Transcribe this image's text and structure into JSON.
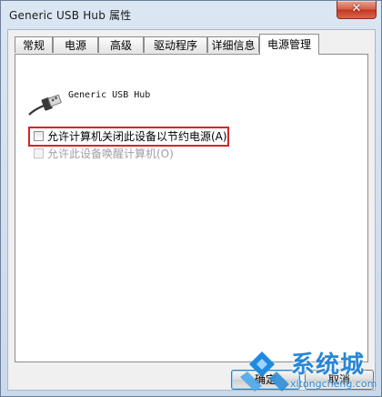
{
  "window": {
    "title": "Generic USB Hub 属性",
    "close_glyph": "✕"
  },
  "tabs": [
    {
      "label": "常规",
      "active": false
    },
    {
      "label": "电源",
      "active": false
    },
    {
      "label": "高级",
      "active": false
    },
    {
      "label": "驱动程序",
      "active": false
    },
    {
      "label": "详细信息",
      "active": false
    },
    {
      "label": "电源管理",
      "active": true
    }
  ],
  "device": {
    "name": "Generic USB Hub",
    "icon": "usb-plug-icon"
  },
  "options": [
    {
      "label": "允许计算机关闭此设备以节约电源(A)",
      "checked": false,
      "enabled": true,
      "highlighted": true
    },
    {
      "label": "允许此设备唤醒计算机(O)",
      "checked": false,
      "enabled": false,
      "highlighted": false
    }
  ],
  "buttons": {
    "ok_label": "确定",
    "cancel_label": "取消"
  },
  "watermark": {
    "brand": "系统城",
    "domain": "xitongcheng.com"
  },
  "colors": {
    "highlight": "#d2252d",
    "watermark": "#2b86d4",
    "close_button": "#c1371f"
  }
}
